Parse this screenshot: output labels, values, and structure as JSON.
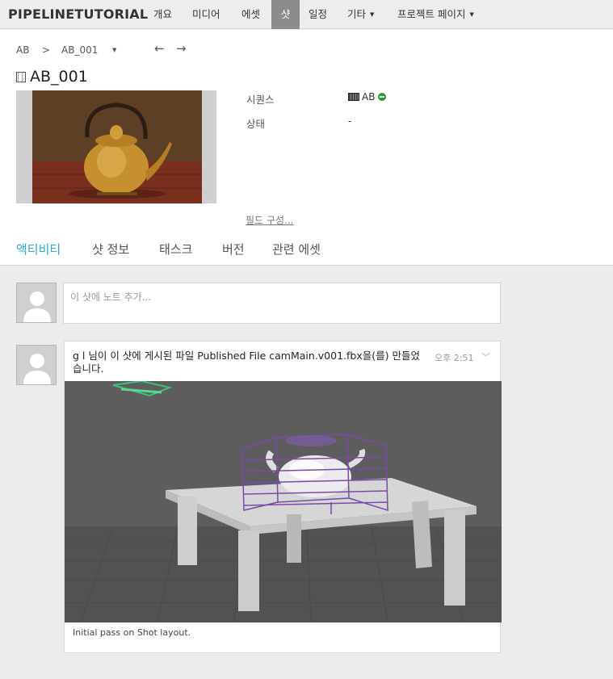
{
  "nav": {
    "brand": "PIPELINETUTORIAL",
    "items": [
      {
        "label": "개요"
      },
      {
        "label": "미디어"
      },
      {
        "label": "에셋"
      },
      {
        "label": "샷"
      },
      {
        "label": "일정"
      },
      {
        "label": "기타"
      },
      {
        "label": "프로젝트 페이지"
      }
    ]
  },
  "breadcrumb": {
    "project": "AB",
    "separator": ">",
    "current": "AB_001"
  },
  "history": {
    "back": "←",
    "forward": "→"
  },
  "shot": {
    "title": "AB_001",
    "fields": [
      {
        "label": "시퀀스",
        "value": "AB"
      },
      {
        "label": "상태",
        "value": "-"
      }
    ],
    "status_color": "#2a9d2a",
    "config_link": "필드 구성..."
  },
  "tabs": [
    {
      "label": "액티비티"
    },
    {
      "label": "샷 정보"
    },
    {
      "label": "태스크"
    },
    {
      "label": "버전"
    },
    {
      "label": "관련 에셋"
    }
  ],
  "accent_color": "#2ba8d8",
  "note_input": {
    "placeholder": "이 샷에 노트 추가..."
  },
  "activity": [
    {
      "text": "g l 님이 이 샷에 게시된 파일 Published File camMain.v001.fbx을(를) 만들었습니다.",
      "time": "오후 2:51",
      "caption": "Initial pass on Shot layout."
    }
  ]
}
